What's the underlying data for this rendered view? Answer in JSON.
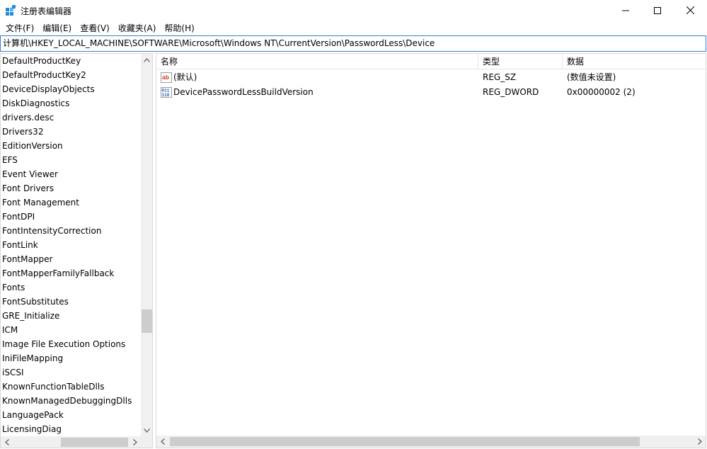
{
  "window": {
    "title": "注册表编辑器"
  },
  "menu": [
    {
      "label": "文件(F)"
    },
    {
      "label": "编辑(E)"
    },
    {
      "label": "查看(V)"
    },
    {
      "label": "收藏夹(A)"
    },
    {
      "label": "帮助(H)"
    }
  ],
  "address": {
    "path": "计算机\\HKEY_LOCAL_MACHINE\\SOFTWARE\\Microsoft\\Windows NT\\CurrentVersion\\PasswordLess\\Device"
  },
  "tree": {
    "items": [
      "DefaultProductKey",
      "DefaultProductKey2",
      "DeviceDisplayObjects",
      "DiskDiagnostics",
      "drivers.desc",
      "Drivers32",
      "EditionVersion",
      "EFS",
      "Event Viewer",
      "Font Drivers",
      "Font Management",
      "FontDPI",
      "FontIntensityCorrection",
      "FontLink",
      "FontMapper",
      "FontMapperFamilyFallback",
      "Fonts",
      "FontSubstitutes",
      "GRE_Initialize",
      "ICM",
      "Image File Execution Options",
      "IniFileMapping",
      "iSCSI",
      "KnownFunctionTableDlls",
      "KnownManagedDebuggingDlls",
      "LanguagePack",
      "LicensingDiag"
    ]
  },
  "list": {
    "columns": [
      {
        "label": "名称"
      },
      {
        "label": "类型"
      },
      {
        "label": "数据"
      }
    ],
    "rows": [
      {
        "icon": "string-value-icon",
        "name": "(默认)",
        "type": "REG_SZ",
        "data": "(数值未设置)"
      },
      {
        "icon": "binary-value-icon",
        "name": "DevicePasswordLessBuildVersion",
        "type": "REG_DWORD",
        "data": "0x00000002 (2)"
      }
    ]
  },
  "colors": {
    "accent": "#3c7fd6",
    "icon_red": "#c0392b",
    "icon_blue": "#1f5fb4"
  }
}
